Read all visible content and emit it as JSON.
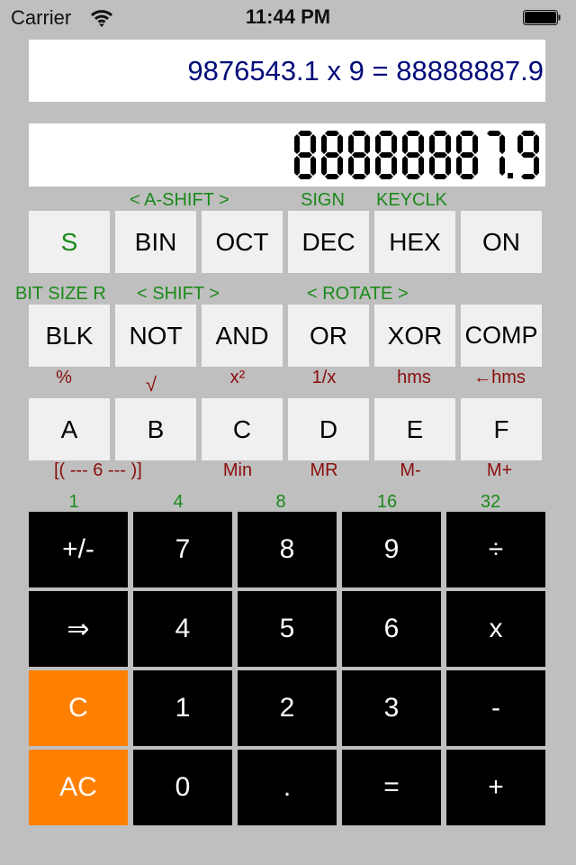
{
  "status_bar": {
    "carrier": "Carrier",
    "time": "11:44 PM",
    "wifi_icon": "wifi-icon",
    "battery_icon": "battery-full-icon"
  },
  "display": {
    "expression": "9876543.1 x 9 = 88888887.9",
    "lcd_value": "88888887.9"
  },
  "row1_labels": {
    "a_shift": "<  A-SHIFT  >",
    "sign": "SIGN",
    "keyclk": "KEYCLK"
  },
  "row1_keys": [
    "S",
    "BIN",
    "OCT",
    "DEC",
    "HEX",
    "ON"
  ],
  "row2_labels": {
    "bit_size": "BIT SIZE R",
    "shift": "<   SHIFT   >",
    "rotate": "<  ROTATE  >"
  },
  "row2_keys": [
    "BLK",
    "NOT",
    "AND",
    "OR",
    "XOR",
    "COMP"
  ],
  "row3_labels": [
    "%",
    "√",
    "x²",
    "1/x",
    "hms",
    "←hms"
  ],
  "row3_keys": [
    "A",
    "B",
    "C",
    "D",
    "E",
    "F"
  ],
  "row4_labels": {
    "paren": "[( --- 6 --- )]",
    "min": "Min",
    "mr": "MR",
    "m_minus": "M-",
    "m_plus": "M+"
  },
  "bit_size_labels": [
    "1",
    "4",
    "8",
    "16",
    "32"
  ],
  "keypad": [
    [
      "+/-",
      "7",
      "8",
      "9",
      "÷"
    ],
    [
      "⇒",
      "4",
      "5",
      "6",
      "x"
    ],
    [
      "C",
      "1",
      "2",
      "3",
      "-"
    ],
    [
      "AC",
      "0",
      ".",
      "=",
      "+"
    ]
  ],
  "colors": {
    "background": "#bfbfbf",
    "expression_text": "#000c7a",
    "green_label": "#1a8a1a",
    "red_label": "#8b0d0d",
    "light_key": "#f0f0f0",
    "dark_key": "#000000",
    "orange_key": "#ff8000"
  }
}
